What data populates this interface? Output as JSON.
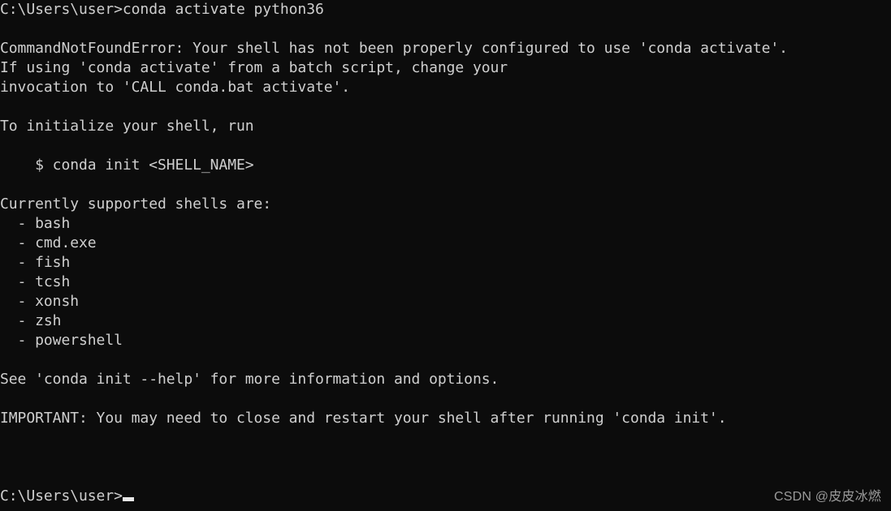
{
  "terminal": {
    "background_color": "#0c0c0c",
    "text_color": "#cfcfcf",
    "cursor_color": "#e8e8e8",
    "lines": [
      "C:\\Users\\user>conda activate python36",
      "",
      "CommandNotFoundError: Your shell has not been properly configured to use 'conda activate'.",
      "If using 'conda activate' from a batch script, change your",
      "invocation to 'CALL conda.bat activate'.",
      "",
      "To initialize your shell, run",
      "",
      "    $ conda init <SHELL_NAME>",
      "",
      "Currently supported shells are:",
      "  - bash",
      "  - cmd.exe",
      "  - fish",
      "  - tcsh",
      "  - xonsh",
      "  - zsh",
      "  - powershell",
      "",
      "See 'conda init --help' for more information and options.",
      "",
      "IMPORTANT: You may need to close and restart your shell after running 'conda init'.",
      "",
      "",
      "",
      ""
    ],
    "command_entered": "conda activate python36",
    "error_name": "CommandNotFoundError",
    "supported_shells": [
      "bash",
      "cmd.exe",
      "fish",
      "tcsh",
      "xonsh",
      "zsh",
      "powershell"
    ],
    "init_example": "$ conda init <SHELL_NAME>",
    "final_prompt": "C:\\Users\\user>"
  },
  "watermark": {
    "text": "CSDN @皮皮冰燃",
    "color": "#9a9a9a"
  }
}
